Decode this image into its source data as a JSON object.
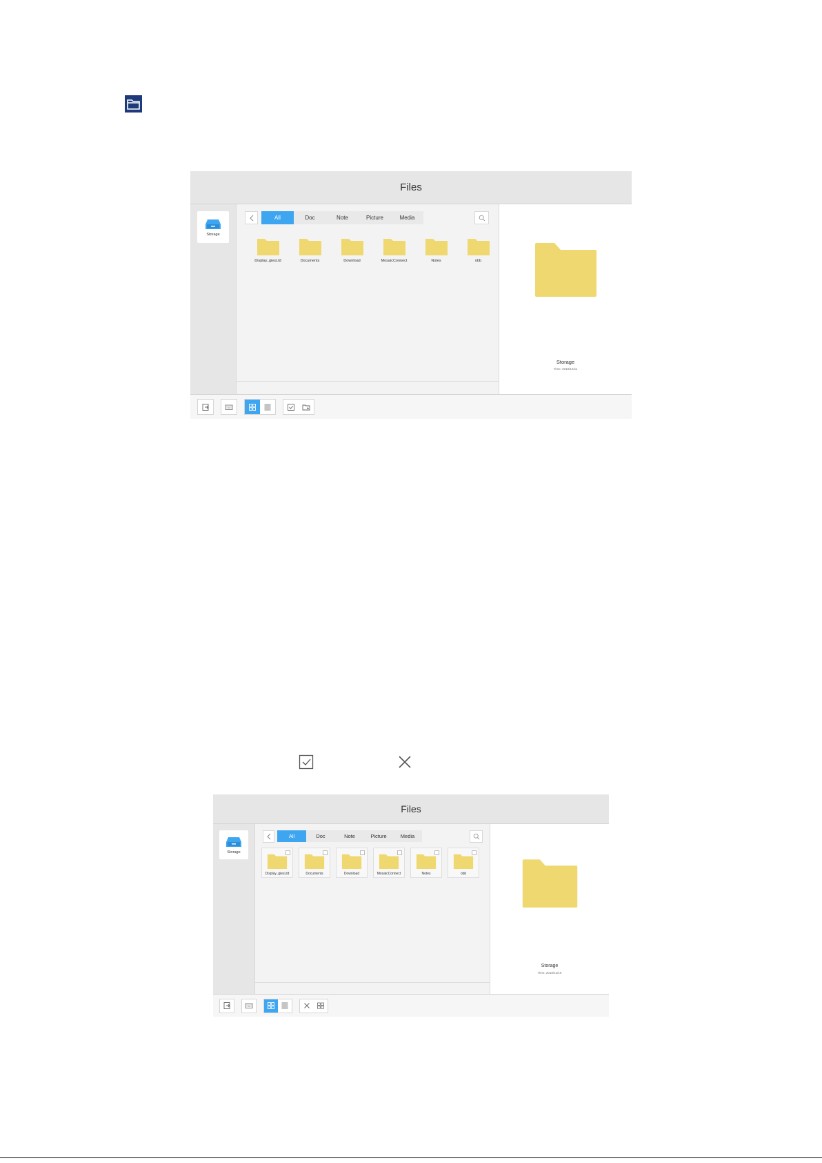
{
  "colors": {
    "accent": "#3ea6f0",
    "folder": "#f0d870",
    "page_icon": "#1f3a7a"
  },
  "icons": {
    "page_icon": "folder-icon",
    "inline_select": "checkbox-icon",
    "inline_close": "close-icon"
  },
  "screens": [
    {
      "title": "Files",
      "storage_label": "Storage",
      "tabs": [
        "All",
        "Doc",
        "Note",
        "Picture",
        "Media"
      ],
      "active_tab": "All",
      "files": [
        "Display..giesLtd",
        "Documents",
        "Download",
        "MosaicConnect",
        "Notes",
        "obb"
      ],
      "selection_mode": false,
      "preview": {
        "name": "Storage",
        "time": "Time: 2018/12/11"
      },
      "toolbar": [
        "exit",
        "keyboard",
        "grid-view",
        "list-view",
        "select",
        "new-folder"
      ]
    },
    {
      "title": "Files",
      "storage_label": "Storage",
      "tabs": [
        "All",
        "Doc",
        "Note",
        "Picture",
        "Media"
      ],
      "active_tab": "All",
      "files": [
        "Display..giesLtd",
        "Documents",
        "Download",
        "MosaicConnect",
        "Notes",
        "obb"
      ],
      "selection_mode": true,
      "preview": {
        "name": "Storage",
        "time": "Time: 2018/12/19"
      },
      "toolbar": [
        "exit",
        "keyboard",
        "grid-view",
        "list-view",
        "cancel",
        "select-all"
      ]
    }
  ]
}
